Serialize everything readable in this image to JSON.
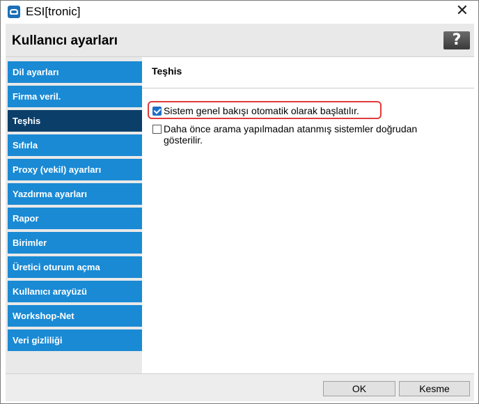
{
  "window": {
    "title": "ESI[tronic]",
    "close_symbol": "✕"
  },
  "header": {
    "title": "Kullanıcı ayarları",
    "help_symbol": "?"
  },
  "sidebar": {
    "items": [
      {
        "label": "Dil ayarları",
        "active": false
      },
      {
        "label": "Firma veril.",
        "active": false
      },
      {
        "label": "Teşhis",
        "active": true
      },
      {
        "label": "Sıfırla",
        "active": false
      },
      {
        "label": "Proxy (vekil) ayarları",
        "active": false
      },
      {
        "label": "Yazdırma ayarları",
        "active": false
      },
      {
        "label": "Rapor",
        "active": false
      },
      {
        "label": "Birimler",
        "active": false
      },
      {
        "label": "Üretici oturum açma",
        "active": false
      },
      {
        "label": "Kullanıcı arayüzü",
        "active": false
      },
      {
        "label": "Workshop-Net",
        "active": false
      },
      {
        "label": "Veri gizliliği",
        "active": false
      }
    ]
  },
  "content": {
    "section_title": "Teşhis",
    "options": [
      {
        "label": "Sistem genel bakışı otomatik olarak başlatılır.",
        "checked": true
      },
      {
        "label": "Daha önce arama yapılmadan atanmış sistemler doğrudan gösterilir.",
        "checked": false
      }
    ]
  },
  "footer": {
    "ok_label": "OK",
    "cancel_label": "Kesme"
  },
  "colors": {
    "nav_item": "#1a8ad4",
    "nav_active": "#0b3f6a",
    "highlight": "#e23a3a",
    "checkbox": "#1e6fc7"
  }
}
